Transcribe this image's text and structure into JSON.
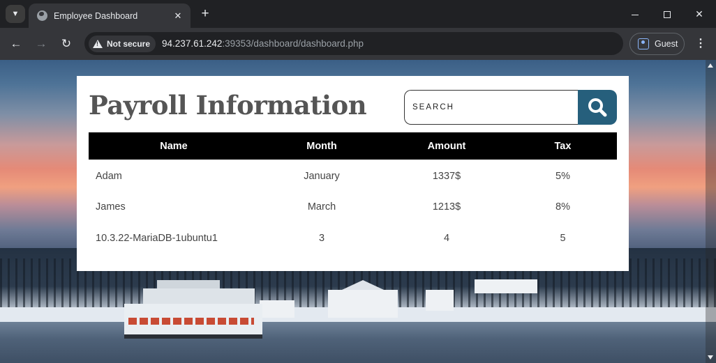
{
  "browser": {
    "tab_title": "Employee Dashboard",
    "tab_close": "✕",
    "new_tab": "+",
    "security_label": "Not secure",
    "url_host": "94.237.61.242",
    "url_rest": ":39353/dashboard/dashboard.php",
    "profile_label": "Guest"
  },
  "page": {
    "title": "Payroll Information",
    "search": {
      "placeholder": "SEARCH",
      "value": ""
    },
    "table": {
      "headers": [
        "Name",
        "Month",
        "Amount",
        "Tax"
      ],
      "rows": [
        [
          "Adam",
          "January",
          "1337$",
          "5%"
        ],
        [
          "James",
          "March",
          "1213$",
          "8%"
        ],
        [
          "10.3.22-MariaDB-1ubuntu1",
          "3",
          "4",
          "5"
        ]
      ]
    }
  },
  "colors": {
    "search_button": "#265f7c",
    "table_header_bg": "#000000",
    "title_text": "#555555"
  },
  "icons": {
    "search": "search-icon",
    "tab_favicon": "globe-icon",
    "security": "warning-icon",
    "profile": "person-icon"
  }
}
